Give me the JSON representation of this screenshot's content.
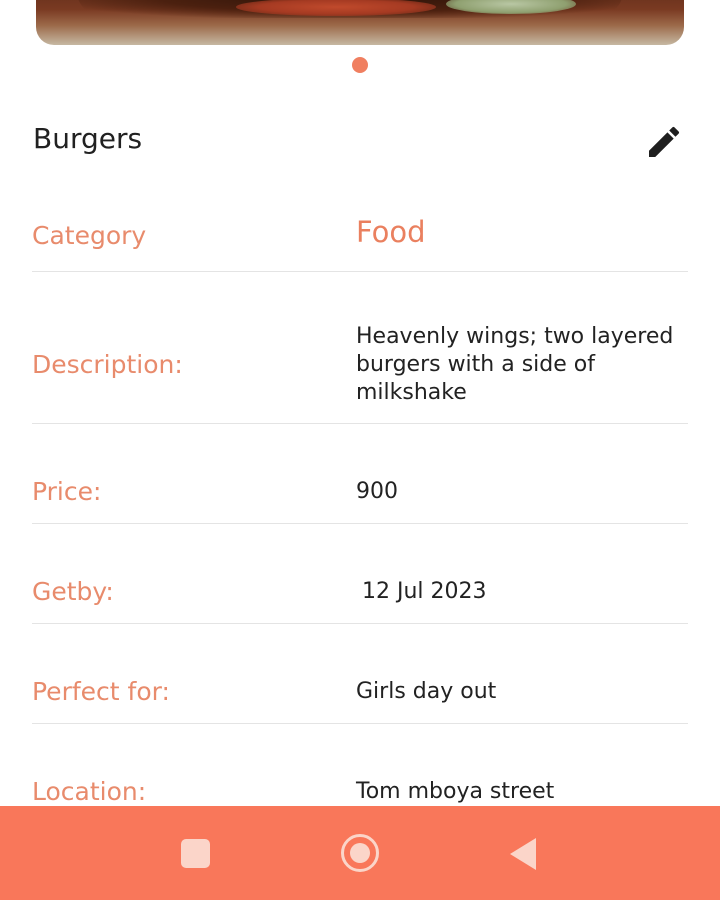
{
  "product": {
    "title": "Burgers",
    "image_pager": {
      "pages": 1,
      "active": 1
    }
  },
  "details": {
    "category": {
      "label": "Category",
      "value": "Food"
    },
    "description": {
      "label": "Description:",
      "value": "Heavenly wings; two layered burgers with a side of milkshake"
    },
    "price": {
      "label": "Price:",
      "value": "900"
    },
    "getby": {
      "label": "Getby:",
      "value": "12 Jul 2023"
    },
    "perfect_for": {
      "label": "Perfect for:",
      "value": "Girls day out"
    },
    "location": {
      "label": "Location:",
      "value": "Tom mboya street"
    }
  },
  "icons": {
    "edit": "edit-icon",
    "nav_recents": "square-icon",
    "nav_home": "circle-icon",
    "nav_back": "back-triangle-icon"
  },
  "colors": {
    "accent": "#f07f60",
    "label": "#e88b6c",
    "navbar": "#f9775a",
    "nav_icon": "#fbd5c9"
  }
}
